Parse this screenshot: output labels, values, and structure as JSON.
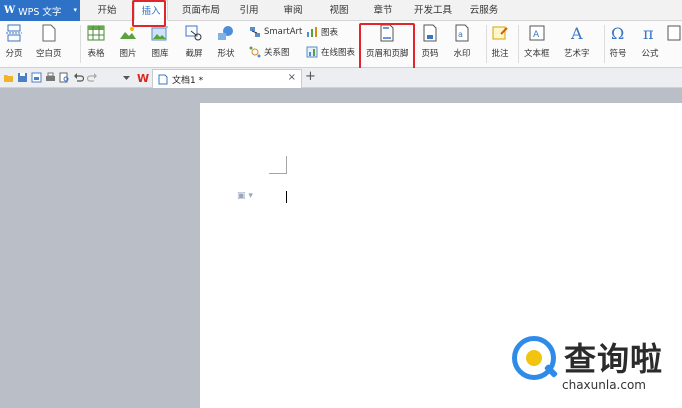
{
  "app": {
    "name": "WPS 文字",
    "logo": "W"
  },
  "tabs": [
    {
      "label": "开始"
    },
    {
      "label": "插入",
      "active": true
    },
    {
      "label": "页面布局"
    },
    {
      "label": "引用"
    },
    {
      "label": "审阅"
    },
    {
      "label": "视图"
    },
    {
      "label": "章节"
    },
    {
      "label": "开发工具"
    },
    {
      "label": "云服务"
    }
  ],
  "ribbon": {
    "page_break": "分页",
    "blank_page": "空白页",
    "table": "表格",
    "picture": "图片",
    "gallery": "图库",
    "screenshot": "截屏",
    "shapes": "形状",
    "relation_chart": "关系图",
    "smartart": "SmartArt",
    "chart": "图表",
    "online_chart": "在线图表",
    "header_footer": "页眉和页脚",
    "page_number": "页码",
    "watermark": "水印",
    "comment": "批注",
    "text_box": "文本框",
    "word_art": "艺术字",
    "symbol": "符号",
    "formula": "公式"
  },
  "document": {
    "tab_title": "文档1 *",
    "close_glyph": "×",
    "new_tab_glyph": "+"
  },
  "watermark": {
    "title": "查询啦",
    "url": "chaxunla.com"
  },
  "colors": {
    "accent": "#2e72c8",
    "highlight": "#e0252b",
    "workspace": "#b9bec7"
  }
}
